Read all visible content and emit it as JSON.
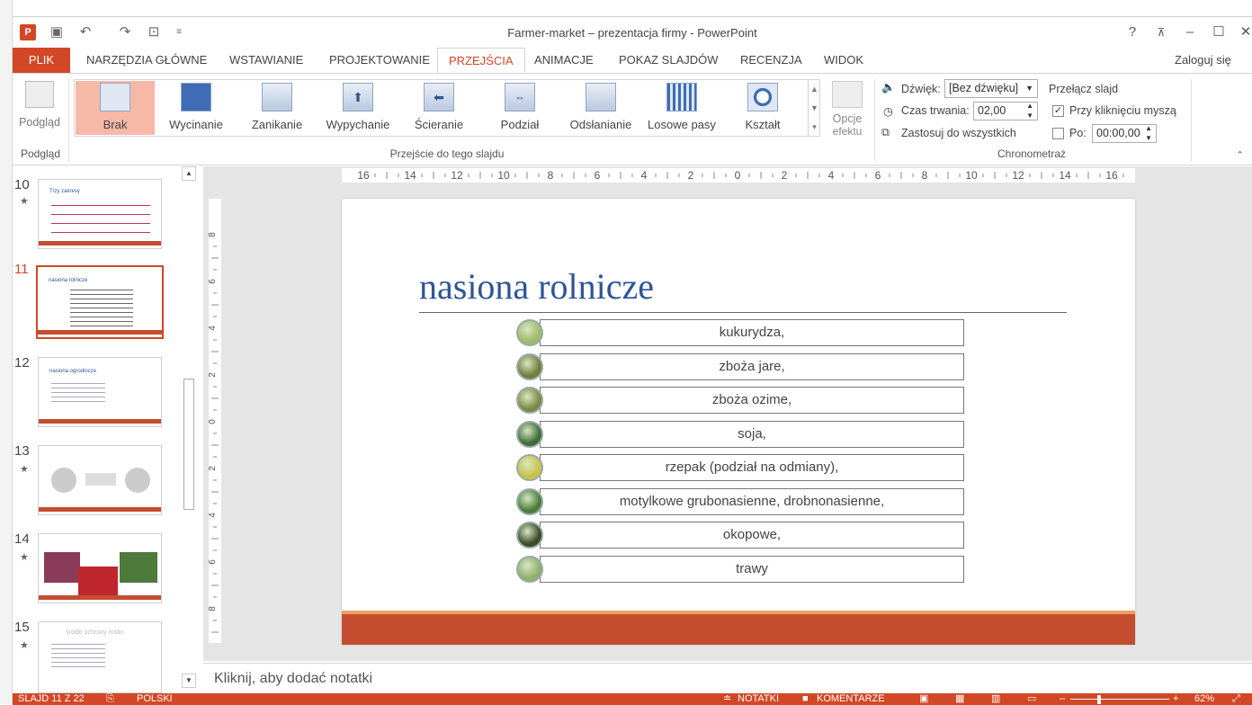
{
  "window": {
    "title": "Farmer-market – prezentacja firmy - PowerPoint",
    "sign_in": "Zaloguj się"
  },
  "tabs": {
    "file": "PLIK",
    "items": [
      "NARZĘDZIA GŁÓWNE",
      "WSTAWIANIE",
      "PROJEKTOWANIE",
      "PRZEJŚCIA",
      "ANIMACJE",
      "POKAZ SLAJDÓW",
      "RECENZJA",
      "WIDOK"
    ],
    "active": "PRZEJŚCIA"
  },
  "ribbon": {
    "preview": {
      "button": "Podgląd",
      "group": "Podgląd"
    },
    "transitions": {
      "group": "Przejście do tego slajdu",
      "items": [
        "Brak",
        "Wycinanie",
        "Zanikanie",
        "Wypychanie",
        "Ścieranie",
        "Podział",
        "Odsłanianie",
        "Losowe pasy",
        "Kształt"
      ],
      "selected": "Brak"
    },
    "effect_options": {
      "line1": "Opcje",
      "line2": "efektu"
    },
    "timing": {
      "group": "Chronometraż",
      "sound_label": "Dźwięk:",
      "sound_value": "[Bez dźwięku]",
      "duration_label": "Czas trwania:",
      "duration_value": "02,00",
      "apply_all": "Zastosuj do wszystkich",
      "advance_title": "Przełącz slajd",
      "on_click_label": "Przy kliknięciu myszą",
      "on_click_checked": true,
      "after_label": "Po:",
      "after_value": "00:00,00",
      "after_checked": false
    }
  },
  "thumbnails": [
    {
      "num": "10",
      "star": true,
      "title": "Trzy zakresy"
    },
    {
      "num": "11",
      "star": false,
      "title": "nasiona rolnicze",
      "selected": true
    },
    {
      "num": "12",
      "star": false,
      "title": "nasiona ogrodnicze"
    },
    {
      "num": "13",
      "star": true,
      "title": ""
    },
    {
      "num": "14",
      "star": true,
      "title": ""
    },
    {
      "num": "15",
      "star": true,
      "title": "środki ochrony roślin"
    }
  ],
  "ruler": {
    "h_ticks": [
      "16",
      "14",
      "12",
      "10",
      "8",
      "6",
      "4",
      "2",
      "0",
      "2",
      "4",
      "6",
      "8",
      "10",
      "12",
      "14",
      "16"
    ],
    "v_ticks": [
      "8",
      "6",
      "4",
      "2",
      "0",
      "2",
      "4",
      "6",
      "8"
    ]
  },
  "slide": {
    "title": "nasiona rolnicze",
    "items": [
      "kukurydza,",
      "zboża jare,",
      "zboża ozime,",
      "soja,",
      "rzepak (podział na odmiany),",
      "motylkowe grubonasienne, drobnonasienne,",
      "okopowe,",
      "trawy"
    ],
    "dot_colors": [
      "#9fb96a",
      "#6e7e3b",
      "#7a8a45",
      "#3d6e3a",
      "#c8c24a",
      "#4a7d3c",
      "#3b4a2a",
      "#8fb06d"
    ]
  },
  "notes": {
    "placeholder": "Kliknij, aby dodać notatki"
  },
  "status": {
    "slide": "SLAJD 11 Z 22",
    "language": "POLSKI",
    "notes": "NOTATKI",
    "comments": "KOMENTARZE",
    "zoom": "62%"
  },
  "colors": {
    "accent": "#d24726",
    "slide_title": "#2f5597",
    "slide_footer": "#c54d2f"
  }
}
